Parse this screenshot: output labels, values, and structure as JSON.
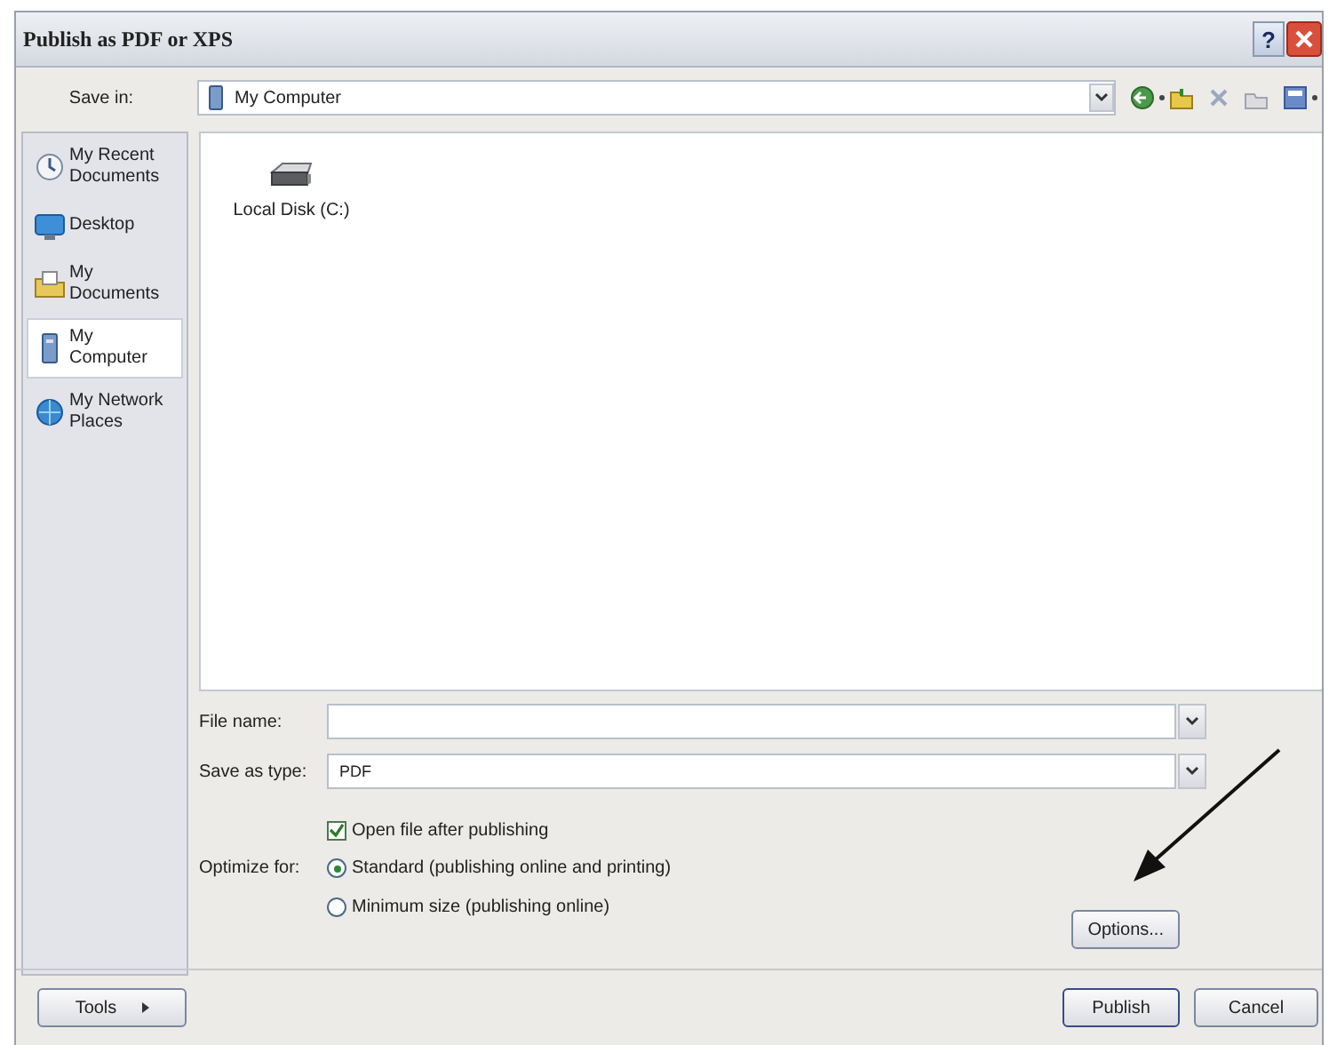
{
  "window": {
    "title": "Publish as PDF or XPS",
    "help_button": "?"
  },
  "save_in": {
    "label": "Save in:",
    "value": "My Computer"
  },
  "sidebar": {
    "items": [
      {
        "label": "My Recent\nDocuments",
        "kind": "recent",
        "selected": false
      },
      {
        "label": "Desktop",
        "kind": "desktop",
        "selected": false
      },
      {
        "label": "My\nDocuments",
        "kind": "documents",
        "selected": false
      },
      {
        "label": "My\nComputer",
        "kind": "computer",
        "selected": true
      },
      {
        "label": "My Network\nPlaces",
        "kind": "network",
        "selected": false
      }
    ]
  },
  "files": [
    {
      "name": "Local Disk (C:)"
    }
  ],
  "file_name": {
    "label": "File name:"
  },
  "save_as_type": {
    "label": "Save as type:",
    "value": "PDF"
  },
  "open_after": {
    "label": "Open file after publishing",
    "checked": true
  },
  "optimize": {
    "label": "Optimize for:",
    "options": [
      {
        "label": "Standard (publishing online and printing)",
        "selected": true
      },
      {
        "label": "Minimum size (publishing online)",
        "selected": false
      }
    ]
  },
  "buttons": {
    "options": "Options...",
    "tools": "Tools",
    "publish": "Publish",
    "cancel": "Cancel"
  }
}
